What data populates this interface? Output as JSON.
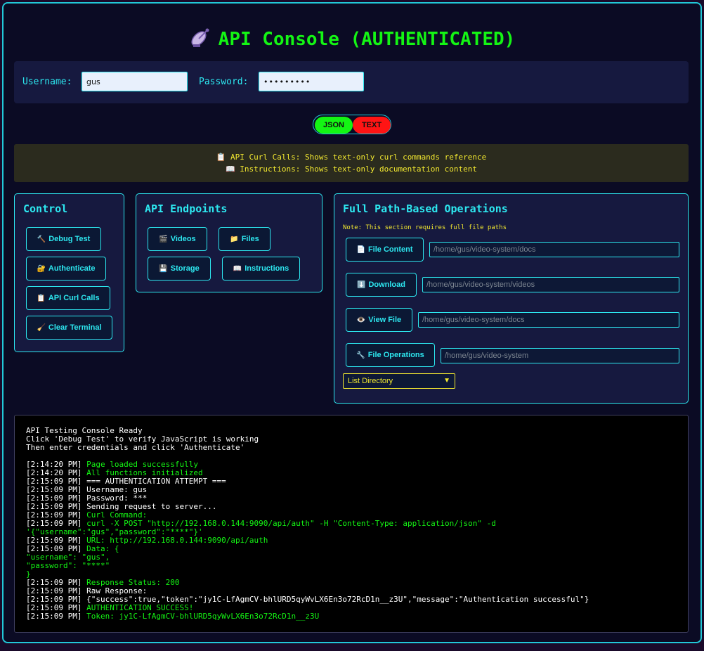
{
  "header": {
    "title": "API Console (AUTHENTICATED)",
    "icon": "satellite-icon"
  },
  "credentials": {
    "username_label": "Username:",
    "username_value": "gus",
    "password_label": "Password:",
    "password_value": "•••••••••"
  },
  "format_toggle": {
    "json_label": "JSON",
    "text_label": "TEXT",
    "json_color": "#14f514",
    "text_color": "#ff1414"
  },
  "info": {
    "line1": "📋 API Curl Calls: Shows text-only curl commands reference",
    "line2": "📖 Instructions: Shows text-only documentation content"
  },
  "control": {
    "title": "Control",
    "buttons": [
      {
        "icon": "🔨",
        "label": "Debug Test"
      },
      {
        "icon": "🔐",
        "label": "Authenticate"
      },
      {
        "icon": "📋",
        "label": "API Curl Calls"
      },
      {
        "icon": "🧹",
        "label": "Clear Terminal"
      }
    ]
  },
  "endpoints": {
    "title": "API Endpoints",
    "buttons": [
      {
        "icon": "🎬",
        "label": "Videos"
      },
      {
        "icon": "📁",
        "label": "Files"
      },
      {
        "icon": "💾",
        "label": "Storage"
      },
      {
        "icon": "📖",
        "label": "Instructions"
      }
    ]
  },
  "operations": {
    "title": "Full Path-Based Operations",
    "note": "Note: This section requires full file paths",
    "rows": [
      {
        "icon": "📄",
        "label": "File Content",
        "path": "/home/gus/video-system/docs"
      },
      {
        "icon": "⬇️",
        "label": "Download",
        "path": "/home/gus/video-system/videos"
      },
      {
        "icon": "👁️",
        "label": "View File",
        "path": "/home/gus/video-system/docs"
      },
      {
        "icon": "🔧",
        "label": "File Operations",
        "path": "/home/gus/video-system"
      }
    ],
    "select_value": "List Directory"
  },
  "terminal": {
    "intro": [
      "API Testing Console Ready",
      "Click 'Debug Test' to verify JavaScript is working",
      "Then enter credentials and click 'Authenticate'"
    ],
    "log": [
      {
        "ts": "[2:14:20 PM]",
        "text": "Page loaded successfully",
        "c": "g"
      },
      {
        "ts": "[2:14:20 PM]",
        "text": "All functions initialized",
        "c": "g"
      },
      {
        "ts": "[2:15:09 PM]",
        "text": "=== AUTHENTICATION ATTEMPT ===",
        "c": "w"
      },
      {
        "ts": "[2:15:09 PM]",
        "text": "Username: gus",
        "c": "w"
      },
      {
        "ts": "[2:15:09 PM]",
        "text": "Password: ***",
        "c": "w"
      },
      {
        "ts": "[2:15:09 PM]",
        "text": "Sending request to server...",
        "c": "w"
      },
      {
        "ts": "[2:15:09 PM]",
        "text": "Curl Command:",
        "c": "g"
      },
      {
        "ts": "[2:15:09 PM]",
        "text": "curl -X POST \"http://192.168.0.144:9090/api/auth\" -H \"Content-Type: application/json\" -d",
        "c": "g"
      },
      {
        "ts": "",
        "text": "'{\"username\":\"gus\",\"password\":\"****\"}'",
        "c": "g"
      },
      {
        "ts": "[2:15:09 PM]",
        "text": "URL: http://192.168.0.144:9090/api/auth",
        "c": "g"
      },
      {
        "ts": "[2:15:09 PM]",
        "text": "Data: {",
        "c": "g"
      },
      {
        "ts": "",
        "text": "\"username\": \"gus\",",
        "c": "g"
      },
      {
        "ts": "",
        "text": "\"password\": \"****\"",
        "c": "g"
      },
      {
        "ts": "",
        "text": "}",
        "c": "g"
      },
      {
        "ts": "[2:15:09 PM]",
        "text": "Response Status: 200",
        "c": "g"
      },
      {
        "ts": "[2:15:09 PM]",
        "text": "Raw Response:",
        "c": "w"
      },
      {
        "ts": "[2:15:09 PM]",
        "text": "{\"success\":true,\"token\":\"jy1C-LfAgmCV-bhlURD5qyWvLX6En3o72RcD1n__z3U\",\"message\":\"Authentication successful\"}",
        "c": "w"
      },
      {
        "ts": "[2:15:09 PM]",
        "text": "AUTHENTICATION SUCCESS!",
        "c": "g"
      },
      {
        "ts": "[2:15:09 PM]",
        "text": "Token: jy1C-LfAgmCV-bhlURD5qyWvLX6En3o72RcD1n__z3U",
        "c": "g"
      }
    ]
  }
}
